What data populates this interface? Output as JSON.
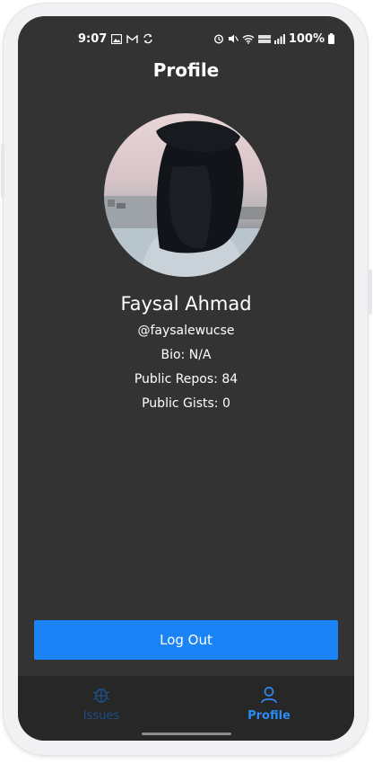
{
  "status_bar": {
    "time": "9:07",
    "left_icons": [
      "image-icon",
      "gmail-icon",
      "sync-icon"
    ],
    "right_icons": [
      "alarm-icon",
      "mute-icon",
      "wifi-icon",
      "volte-icon",
      "signal-icon",
      "battery-icon"
    ],
    "battery": "100%"
  },
  "header": {
    "title": "Profile"
  },
  "profile": {
    "name": "Faysal Ahmad",
    "username": "@faysalewucse",
    "bio": "Bio: N/A",
    "public_repos": "Public Repos: 84",
    "public_gists": "Public Gists: 0"
  },
  "actions": {
    "logout_label": "Log Out"
  },
  "bottom_nav": {
    "items": [
      {
        "label": "Issues",
        "icon": "bug-icon",
        "active": false
      },
      {
        "label": "Profile",
        "icon": "person-icon",
        "active": true
      }
    ]
  },
  "colors": {
    "background": "#333333",
    "accent": "#1a83f5",
    "nav_background": "#272727",
    "nav_inactive": "#1f4d86"
  }
}
